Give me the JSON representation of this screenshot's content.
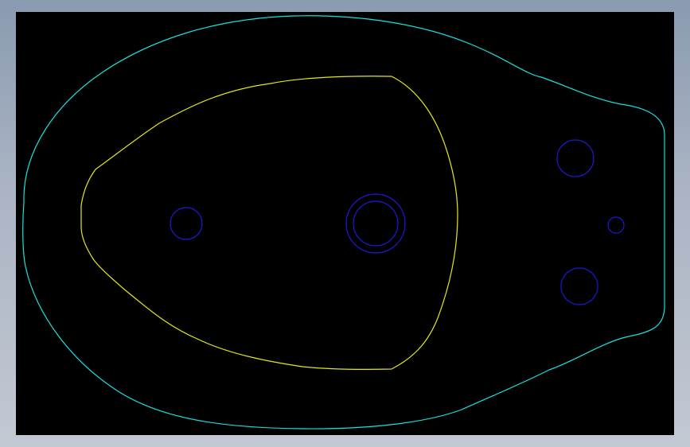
{
  "colors": {
    "frame": "#9aa6b8",
    "background": "#000000",
    "outer_profile": "#19e0e0",
    "inner_profile": "#e6e619",
    "holes": "#1a1ad8"
  },
  "drawing": {
    "outer_profile": {
      "kind": "closed-contour",
      "color_role": "outer_profile"
    },
    "inner_profile": {
      "kind": "closed-contour",
      "color_role": "inner_profile"
    },
    "holes": [
      {
        "id": "left-hole",
        "kind": "circle"
      },
      {
        "id": "center-boss",
        "kind": "concentric-circles"
      },
      {
        "id": "right-upper-hole",
        "kind": "circle"
      },
      {
        "id": "right-small-hole",
        "kind": "circle"
      },
      {
        "id": "right-lower-hole",
        "kind": "circle"
      }
    ]
  }
}
